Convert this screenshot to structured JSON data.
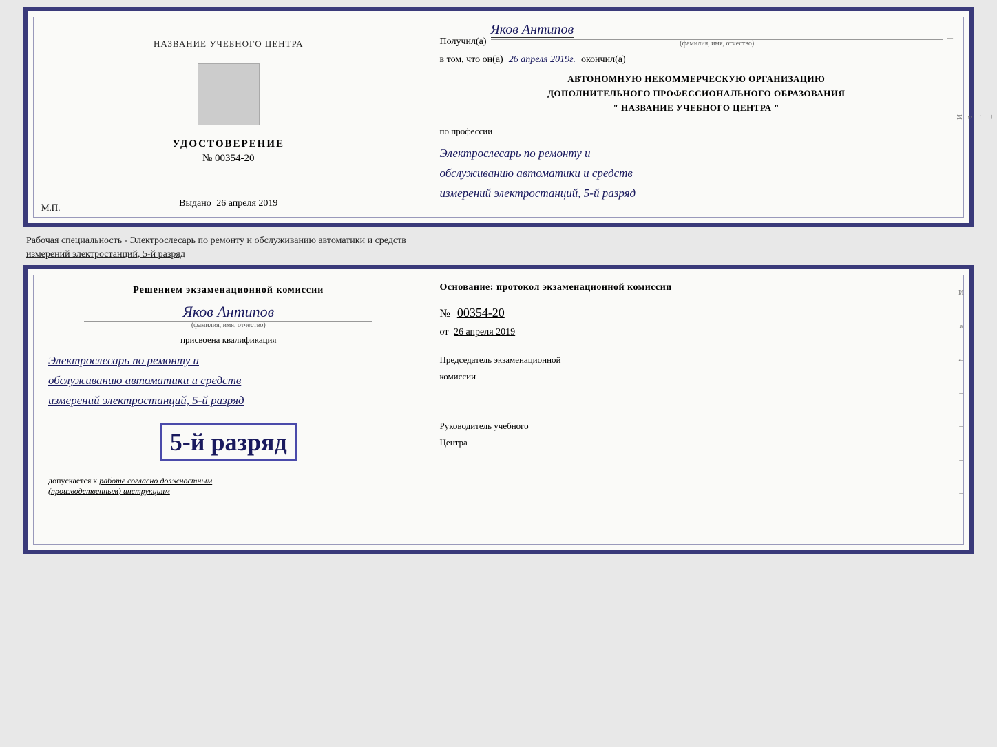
{
  "top_cert": {
    "left": {
      "school_label": "НАЗВАНИЕ УЧЕБНОГО ЦЕНТРА",
      "cert_title": "УДОСТОВЕРЕНИЕ",
      "cert_number": "№ 00354-20",
      "issued_label": "Выдано",
      "issued_date": "26 апреля 2019",
      "mp_label": "М.П."
    },
    "right": {
      "poluchil_prefix": "Получил(а)",
      "recipient_name": "Яков Антипов",
      "fio_subtitle": "(фамилия, имя, отчество)",
      "vtom_prefix": "в том, что он(а)",
      "vtom_date": "26 апреля 2019г.",
      "okonchil": "окончил(а)",
      "org_line1": "АВТОНОМНУЮ НЕКОММЕРЧЕСКУЮ ОРГАНИЗАЦИЮ",
      "org_line2": "ДОПОЛНИТЕЛЬНОГО ПРОФЕССИОНАЛЬНОГО ОБРАЗОВАНИЯ",
      "org_quote_open": "\"",
      "org_name": "НАЗВАНИЕ УЧЕБНОГО ЦЕНТРА",
      "org_quote_close": "\"",
      "po_professii": "по профессии",
      "profession_line1": "Электрослесарь по ремонту и",
      "profession_line2": "обслуживанию автоматики и средств",
      "profession_line3": "измерений электростанций, 5-й разряд"
    }
  },
  "between_text": {
    "line1": "Рабочая специальность - Электрослесарь по ремонту и обслуживанию автоматики и средств",
    "line2": "измерений электростанций, 5-й разряд"
  },
  "bottom_cert": {
    "left": {
      "commission_title": "Решением экзаменационной комиссии",
      "person_name": "Яков Антипов",
      "fio_subtitle": "(фамилия, имя, отчество)",
      "prisvoena": "присвоена квалификация",
      "profession_line1": "Электрослесарь по ремонту и",
      "profession_line2": "обслуживанию автоматики и средств",
      "profession_line3": "измерений электростанций, 5-й разряд",
      "big_rank": "5-й разряд",
      "dopuskaetsya_prefix": "допускается к",
      "dopuskaetsya_text": "работе согласно должностным",
      "dopuskaetsya_text2": "(производственным) инструкциям"
    },
    "right": {
      "osnov_label": "Основание: протокол экзаменационной комиссии",
      "number_label": "№",
      "number_value": "00354-20",
      "ot_label": "от",
      "ot_date": "26 апреля 2019",
      "chairman_label": "Председатель экзаменационной",
      "commission_label": "комиссии",
      "director_label": "Руководитель учебного",
      "center_label": "Центра"
    }
  },
  "side_chars": [
    "И",
    "а",
    "←",
    "–",
    "–",
    "–"
  ],
  "side_chars_bottom": [
    "И",
    "а",
    "←",
    "–",
    "–",
    "–",
    "–",
    "–"
  ]
}
